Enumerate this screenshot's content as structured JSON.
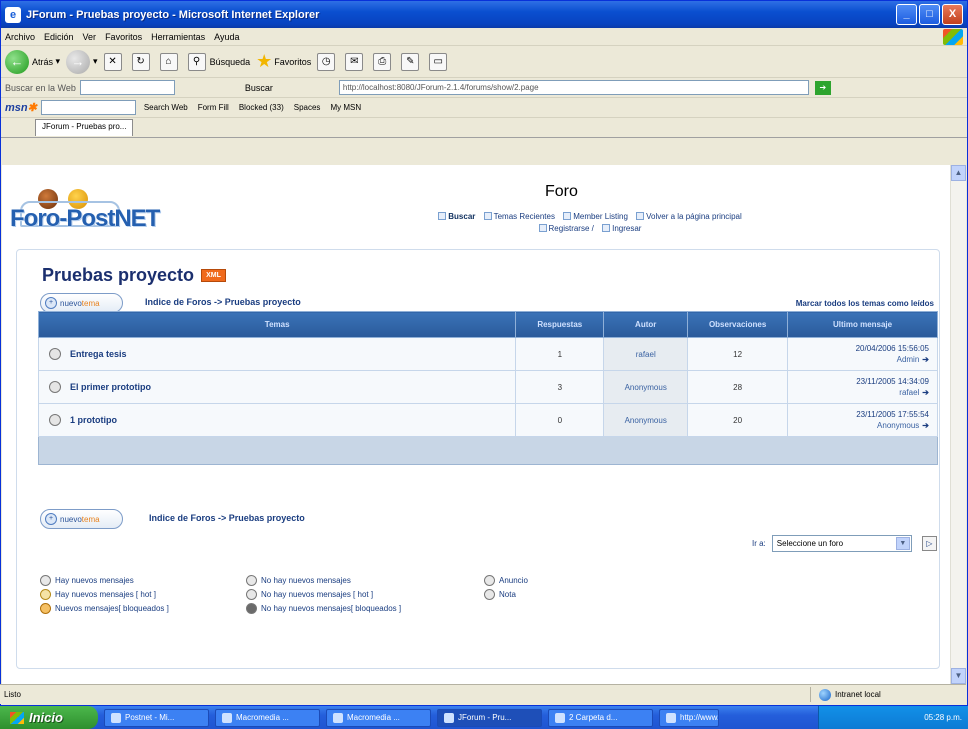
{
  "window": {
    "title": "JForum - Pruebas proyecto - Microsoft Internet Explorer",
    "minimize": "_",
    "maximize": "□",
    "close": "X"
  },
  "menu": [
    "Archivo",
    "Edición",
    "Ver",
    "Favoritos",
    "Herramientas",
    "Ayuda"
  ],
  "toolbar": {
    "back_label": "Atrás",
    "search_label": "Búsqueda",
    "favorites_label": "Favoritos"
  },
  "addressbar": {
    "search_label": "Buscar en la Web",
    "buscar_button": "Buscar",
    "address_value": "http://localhost:8080/JForum-2.1.4/forums/show/2.page"
  },
  "msnbar": {
    "search_web": "Search Web",
    "form_fill": "Form Fill",
    "blocked": "Blocked (33)",
    "spaces": "Spaces",
    "my_msn": "My MSN"
  },
  "tab": {
    "label": "JForum - Pruebas pro..."
  },
  "site": {
    "logo_text": "Foro-PostNET",
    "header_title": "Foro",
    "links": {
      "buscar": "Buscar",
      "temas_recientes": "Temas Recientes",
      "member_listing": "Member Listing",
      "volver": "Volver a la página principal",
      "registrarse": "Registrarse /",
      "ingresar": "Ingresar"
    }
  },
  "forum": {
    "title": "Pruebas proyecto",
    "xml_badge": "XML",
    "newtopic_nuevo": "nuevo",
    "newtopic_tema": "tema",
    "breadcrumb": "Indice de Foros -> Pruebas proyecto",
    "mark_all": "Marcar todos los temas como leídos"
  },
  "table": {
    "headers": {
      "topics": "Temas",
      "replies": "Respuestas",
      "author": "Autor",
      "views": "Observaciones",
      "last": "Ultimo mensaje"
    },
    "rows": [
      {
        "title": "Entrega tesis",
        "replies": "1",
        "author": "rafael",
        "views": "12",
        "last_date": "20/04/2006 15:56:05",
        "last_by": "Admin"
      },
      {
        "title": "El primer prototipo",
        "replies": "3",
        "author": "Anonymous",
        "views": "28",
        "last_date": "23/11/2005 14:34:09",
        "last_by": "rafael"
      },
      {
        "title": "1 prototipo",
        "replies": "0",
        "author": "Anonymous",
        "views": "20",
        "last_date": "23/11/2005 17:55:54",
        "last_by": "Anonymous"
      }
    ]
  },
  "jump": {
    "label": "Ir a:",
    "select_value": "Seleccione un foro"
  },
  "legend": {
    "new_posts": "Hay nuevos mensajes",
    "new_posts_hot": "Hay nuevos mensajes [ hot ]",
    "new_posts_locked": "Nuevos mensajes[ bloqueados ]",
    "no_new": "No hay nuevos mensajes",
    "no_new_hot": "No hay nuevos mensajes [ hot ]",
    "no_new_locked": "No hay nuevos mensajes[ bloqueados ]",
    "announce": "Anuncio",
    "sticky": "Nota"
  },
  "status": {
    "left": "Listo",
    "zone": "Intranet local"
  },
  "taskbar": {
    "start": "Inicio",
    "tasks": [
      "Postnet - Mi...",
      "Macromedia ...",
      "Macromedia ...",
      "JForum - Pru...",
      "2 Carpeta d...",
      "http://www...."
    ],
    "clock": "05:28 p.m."
  }
}
